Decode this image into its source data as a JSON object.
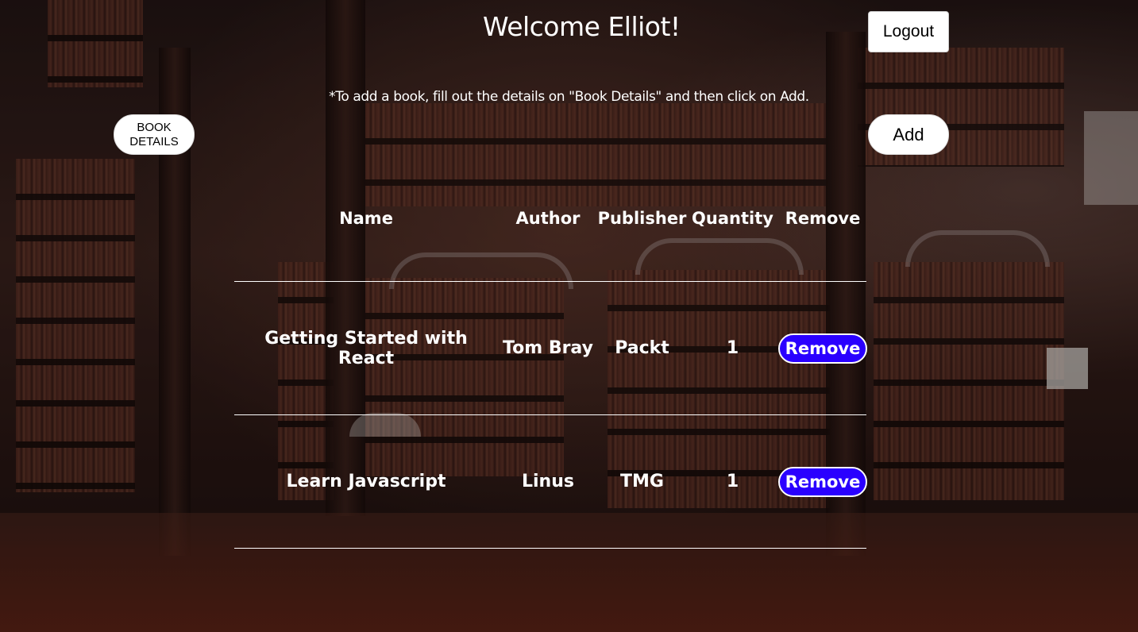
{
  "header": {
    "welcome": "Welcome Elliot!",
    "logout_label": "Logout"
  },
  "hint": "*To add a book, fill out the details on \"Book Details\" and then click on Add.",
  "buttons": {
    "book_details_label": "BOOK\nDETAILS",
    "add_label": "Add"
  },
  "table": {
    "columns": [
      "Name",
      "Author",
      "Publisher",
      "Quantity",
      "Remove"
    ],
    "rows": [
      {
        "name": "Getting Started with React",
        "author": "Tom Bray",
        "publisher": "Packt",
        "quantity": "1",
        "remove_label": "Remove"
      },
      {
        "name": "Learn Javascript",
        "author": "Linus",
        "publisher": "TMG",
        "quantity": "1",
        "remove_label": "Remove"
      }
    ]
  },
  "colors": {
    "remove_button": "#2a00ff",
    "text": "#ffffff"
  }
}
